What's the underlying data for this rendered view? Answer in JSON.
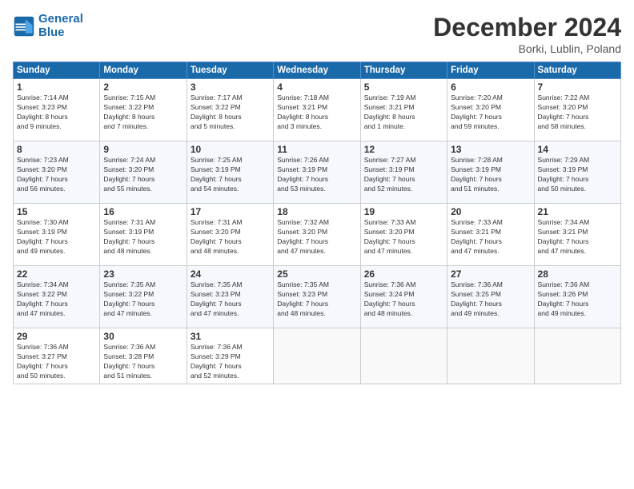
{
  "header": {
    "logo_line1": "General",
    "logo_line2": "Blue",
    "month": "December 2024",
    "location": "Borki, Lublin, Poland"
  },
  "days_of_week": [
    "Sunday",
    "Monday",
    "Tuesday",
    "Wednesday",
    "Thursday",
    "Friday",
    "Saturday"
  ],
  "weeks": [
    [
      {
        "day": "1",
        "info": "Sunrise: 7:14 AM\nSunset: 3:23 PM\nDaylight: 8 hours\nand 9 minutes."
      },
      {
        "day": "2",
        "info": "Sunrise: 7:15 AM\nSunset: 3:22 PM\nDaylight: 8 hours\nand 7 minutes."
      },
      {
        "day": "3",
        "info": "Sunrise: 7:17 AM\nSunset: 3:22 PM\nDaylight: 8 hours\nand 5 minutes."
      },
      {
        "day": "4",
        "info": "Sunrise: 7:18 AM\nSunset: 3:21 PM\nDaylight: 8 hours\nand 3 minutes."
      },
      {
        "day": "5",
        "info": "Sunrise: 7:19 AM\nSunset: 3:21 PM\nDaylight: 8 hours\nand 1 minute."
      },
      {
        "day": "6",
        "info": "Sunrise: 7:20 AM\nSunset: 3:20 PM\nDaylight: 7 hours\nand 59 minutes."
      },
      {
        "day": "7",
        "info": "Sunrise: 7:22 AM\nSunset: 3:20 PM\nDaylight: 7 hours\nand 58 minutes."
      }
    ],
    [
      {
        "day": "8",
        "info": "Sunrise: 7:23 AM\nSunset: 3:20 PM\nDaylight: 7 hours\nand 56 minutes."
      },
      {
        "day": "9",
        "info": "Sunrise: 7:24 AM\nSunset: 3:20 PM\nDaylight: 7 hours\nand 55 minutes."
      },
      {
        "day": "10",
        "info": "Sunrise: 7:25 AM\nSunset: 3:19 PM\nDaylight: 7 hours\nand 54 minutes."
      },
      {
        "day": "11",
        "info": "Sunrise: 7:26 AM\nSunset: 3:19 PM\nDaylight: 7 hours\nand 53 minutes."
      },
      {
        "day": "12",
        "info": "Sunrise: 7:27 AM\nSunset: 3:19 PM\nDaylight: 7 hours\nand 52 minutes."
      },
      {
        "day": "13",
        "info": "Sunrise: 7:28 AM\nSunset: 3:19 PM\nDaylight: 7 hours\nand 51 minutes."
      },
      {
        "day": "14",
        "info": "Sunrise: 7:29 AM\nSunset: 3:19 PM\nDaylight: 7 hours\nand 50 minutes."
      }
    ],
    [
      {
        "day": "15",
        "info": "Sunrise: 7:30 AM\nSunset: 3:19 PM\nDaylight: 7 hours\nand 49 minutes."
      },
      {
        "day": "16",
        "info": "Sunrise: 7:31 AM\nSunset: 3:19 PM\nDaylight: 7 hours\nand 48 minutes."
      },
      {
        "day": "17",
        "info": "Sunrise: 7:31 AM\nSunset: 3:20 PM\nDaylight: 7 hours\nand 48 minutes."
      },
      {
        "day": "18",
        "info": "Sunrise: 7:32 AM\nSunset: 3:20 PM\nDaylight: 7 hours\nand 47 minutes."
      },
      {
        "day": "19",
        "info": "Sunrise: 7:33 AM\nSunset: 3:20 PM\nDaylight: 7 hours\nand 47 minutes."
      },
      {
        "day": "20",
        "info": "Sunrise: 7:33 AM\nSunset: 3:21 PM\nDaylight: 7 hours\nand 47 minutes."
      },
      {
        "day": "21",
        "info": "Sunrise: 7:34 AM\nSunset: 3:21 PM\nDaylight: 7 hours\nand 47 minutes."
      }
    ],
    [
      {
        "day": "22",
        "info": "Sunrise: 7:34 AM\nSunset: 3:22 PM\nDaylight: 7 hours\nand 47 minutes."
      },
      {
        "day": "23",
        "info": "Sunrise: 7:35 AM\nSunset: 3:22 PM\nDaylight: 7 hours\nand 47 minutes."
      },
      {
        "day": "24",
        "info": "Sunrise: 7:35 AM\nSunset: 3:23 PM\nDaylight: 7 hours\nand 47 minutes."
      },
      {
        "day": "25",
        "info": "Sunrise: 7:35 AM\nSunset: 3:23 PM\nDaylight: 7 hours\nand 48 minutes."
      },
      {
        "day": "26",
        "info": "Sunrise: 7:36 AM\nSunset: 3:24 PM\nDaylight: 7 hours\nand 48 minutes."
      },
      {
        "day": "27",
        "info": "Sunrise: 7:36 AM\nSunset: 3:25 PM\nDaylight: 7 hours\nand 49 minutes."
      },
      {
        "day": "28",
        "info": "Sunrise: 7:36 AM\nSunset: 3:26 PM\nDaylight: 7 hours\nand 49 minutes."
      }
    ],
    [
      {
        "day": "29",
        "info": "Sunrise: 7:36 AM\nSunset: 3:27 PM\nDaylight: 7 hours\nand 50 minutes."
      },
      {
        "day": "30",
        "info": "Sunrise: 7:36 AM\nSunset: 3:28 PM\nDaylight: 7 hours\nand 51 minutes."
      },
      {
        "day": "31",
        "info": "Sunrise: 7:36 AM\nSunset: 3:29 PM\nDaylight: 7 hours\nand 52 minutes."
      },
      {
        "day": "",
        "info": ""
      },
      {
        "day": "",
        "info": ""
      },
      {
        "day": "",
        "info": ""
      },
      {
        "day": "",
        "info": ""
      }
    ]
  ]
}
